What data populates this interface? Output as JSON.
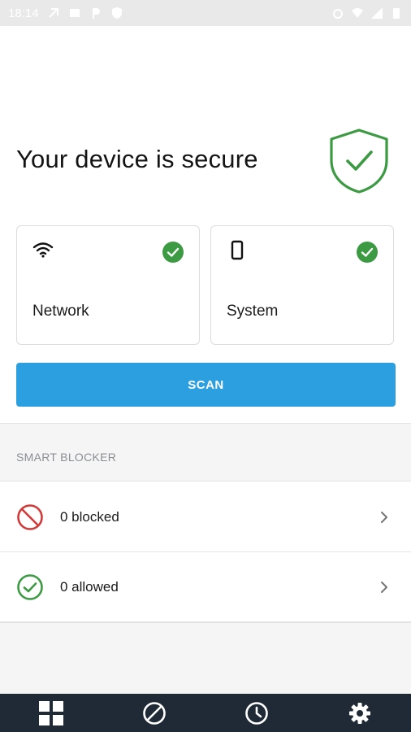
{
  "status_bar": {
    "time": "18:14"
  },
  "hero": {
    "title": "Your device is secure",
    "status": "secure"
  },
  "cards": [
    {
      "label": "Network",
      "icon": "wifi-icon",
      "status": "ok"
    },
    {
      "label": "System",
      "icon": "phone-icon",
      "status": "ok"
    }
  ],
  "scan_button": {
    "label": "SCAN"
  },
  "smart_blocker": {
    "title": "SMART BLOCKER",
    "rows": [
      {
        "label": "0 blocked",
        "icon": "blocked-icon"
      },
      {
        "label": "0 allowed",
        "icon": "allowed-icon"
      }
    ]
  },
  "bottom_nav": [
    {
      "icon": "dashboard-grid-icon"
    },
    {
      "icon": "block-icon"
    },
    {
      "icon": "history-clock-icon"
    },
    {
      "icon": "settings-gear-icon"
    }
  ],
  "colors": {
    "accent": "#2b9fdf",
    "success": "#3c9a43",
    "danger": "#d23a3a",
    "nav_bg": "#1f2a36"
  }
}
